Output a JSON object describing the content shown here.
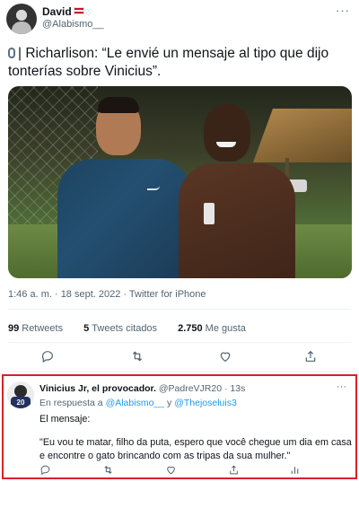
{
  "tweet": {
    "display_name": "David",
    "handle": "@Alabismo__",
    "more": "···",
    "text": "| Richarlison: “Le envié un mensaje al tipo que dijo tonterías sobre Vinicius”.",
    "timestamp": "1:46 a. m. · 18 sept. 2022 · Twitter for iPhone",
    "stats": {
      "retweets_count": "99",
      "retweets_label": "Retweets",
      "quotes_count": "5",
      "quotes_label": "Tweets citados",
      "likes_count": "2.750",
      "likes_label": "Me gusta"
    },
    "actions": [
      "reply-icon",
      "retweet-icon",
      "like-icon",
      "share-icon"
    ]
  },
  "reply": {
    "display_name": "Vinicius Jr, el provocador.",
    "handle": "@PadreVJR20",
    "separator": "·",
    "time": "13s",
    "more": "···",
    "replying_prefix": "En respuesta a",
    "mention_1": "@Alabismo__",
    "connector": "y",
    "mention_2": "@Thejoseluis3",
    "body_line_1": "El mensaje:",
    "body_line_2": "\"Eu vou te matar, filho da puta, espero que você chegue um dia em casa e encontre o gato brincando com as tripas da sua mulher.\"",
    "actions": [
      "reply-icon",
      "retweet-icon",
      "like-icon",
      "share-icon",
      "analytics-icon"
    ]
  },
  "colors": {
    "text": "#0f1419",
    "secondary": "#536471",
    "mention": "#1d9bf0",
    "highlight_border": "#d8202a"
  }
}
